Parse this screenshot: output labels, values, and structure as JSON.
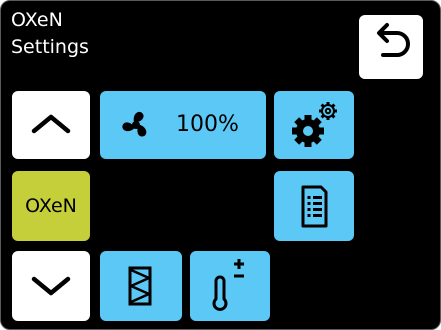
{
  "header": {
    "line1": "OXeN",
    "line2": "Settings"
  },
  "buttons": {
    "back": {
      "icon": "back-arrow-icon"
    },
    "scroll_up": {
      "icon": "chevron-up-icon"
    },
    "fan": {
      "icon": "fan-icon",
      "value": "100%"
    },
    "settings": {
      "icon": "gears-icon"
    },
    "mode": {
      "label": "OXeN"
    },
    "document": {
      "icon": "document-icon"
    },
    "scroll_down": {
      "icon": "chevron-down-icon"
    },
    "filter": {
      "icon": "filter-icon"
    },
    "temperature": {
      "icon": "thermometer-plus-minus-icon"
    }
  },
  "colors": {
    "blue": "#5bc8f5",
    "olive": "#c4cf3a",
    "white": "#ffffff",
    "background": "#000000"
  }
}
